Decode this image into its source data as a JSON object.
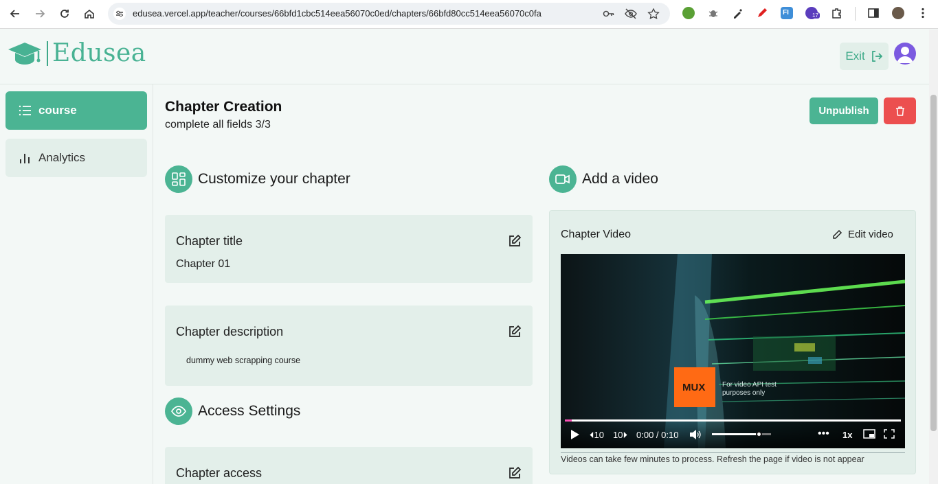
{
  "browser": {
    "url": "edusea.vercel.app/teacher/courses/66bfd1cbc514eea56070c0ed/chapters/66bfd80cc514eea56070c0fa",
    "extension_badge": "17"
  },
  "header": {
    "logo_text": "Edusea",
    "exit_label": "Exit"
  },
  "sidebar": {
    "items": [
      {
        "label": "course",
        "icon": "list-icon"
      },
      {
        "label": "Analytics",
        "icon": "bar-chart-icon"
      }
    ]
  },
  "main": {
    "title": "Chapter Creation",
    "subtitle": "complete all fields 3/3",
    "unpublish_label": "Unpublish",
    "sections": {
      "customize": "Customize your chapter",
      "video": "Add a video",
      "access": "Access Settings"
    },
    "chapter_title": {
      "label": "Chapter title",
      "value": "Chapter 01"
    },
    "chapter_description": {
      "label": "Chapter description",
      "value": "dummy web scrapping course"
    },
    "chapter_access": {
      "label": "Chapter access"
    },
    "video": {
      "label": "Chapter Video",
      "edit_label": "Edit video",
      "note": "Videos can take few minutes to process. Refresh the page if video is not appear",
      "player": {
        "time": "0:00 / 0:10",
        "rewind": "10",
        "forward": "10",
        "speed": "1x",
        "watermark": "MUX",
        "watermark_note": "For video API test purposes only",
        "progress": 0.02,
        "volume": 0.8
      }
    }
  },
  "colors": {
    "accent": "#4bb493",
    "danger": "#ec4f4f",
    "card_bg": "#e3efea"
  }
}
